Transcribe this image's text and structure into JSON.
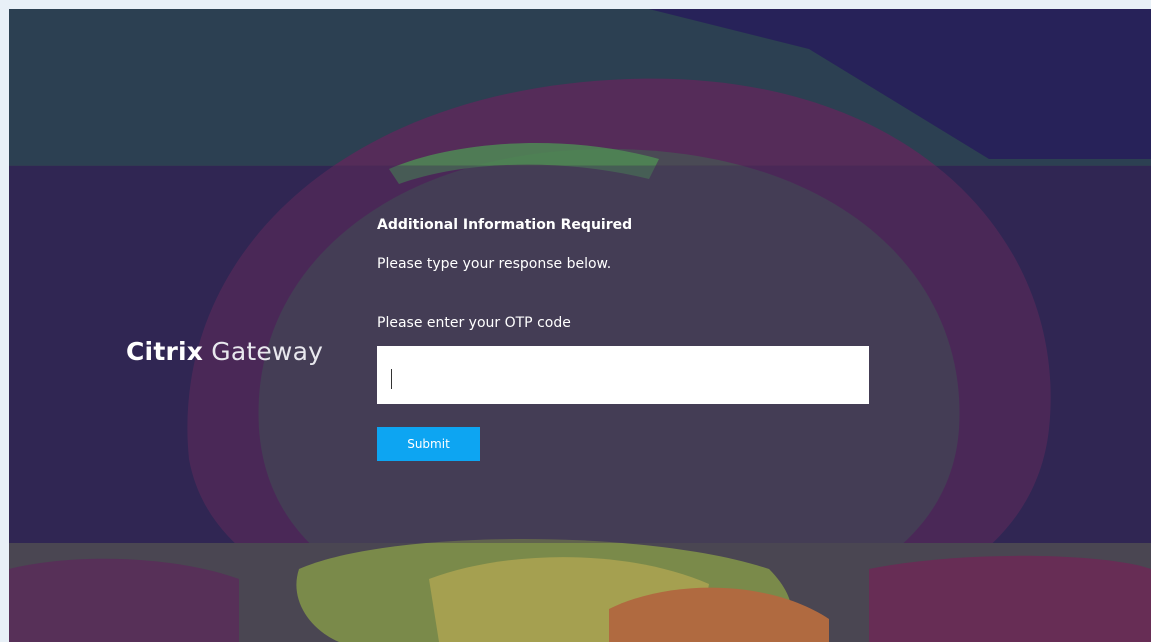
{
  "brand": {
    "name_bold": "Citrix",
    "name_light": "Gateway"
  },
  "form": {
    "title": "Additional Information Required",
    "subtitle": "Please type your response below.",
    "otp_label": "Please enter your OTP code",
    "otp_value": "",
    "submit_label": "Submit"
  },
  "colors": {
    "accent": "#0da5f2",
    "background": "#2a2552"
  }
}
